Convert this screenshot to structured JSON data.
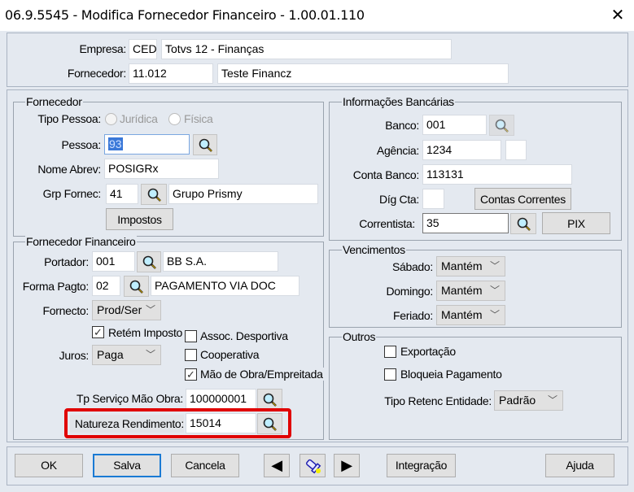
{
  "window": {
    "title": "06.9.5545 - Modifica Fornecedor Financeiro - 1.00.01.110",
    "close_icon": "close-icon"
  },
  "header": {
    "empresa_label": "Empresa:",
    "empresa_code": "CED",
    "empresa_name": "Totvs 12 - Finanças",
    "fornecedor_label": "Fornecedor:",
    "fornecedor_code": "11.012",
    "fornecedor_name": "Teste Financz"
  },
  "fornecedor": {
    "legend": "Fornecedor",
    "tipo_pessoa_label": "Tipo Pessoa:",
    "juridica": "Jurídica",
    "fisica": "Física",
    "pessoa_label": "Pessoa:",
    "pessoa": "93",
    "nome_abrev_label": "Nome Abrev:",
    "nome_abrev": "POSIGRx",
    "grp_label": "Grp Fornec:",
    "grp_code": "41",
    "grp_name": "Grupo Prismy",
    "impostos": "Impostos"
  },
  "financeiro": {
    "legend": "Fornecedor Financeiro",
    "portador_label": "Portador:",
    "portador_code": "001",
    "portador_name": "BB S.A.",
    "forma_label": "Forma Pagto:",
    "forma_code": "02",
    "forma_name": "PAGAMENTO VIA DOC",
    "fornecto_label": "Fornecto:",
    "fornecto": "Prod/Ser",
    "retem": "Retém Imposto",
    "juros_label": "Juros:",
    "juros": "Paga",
    "assoc": "Assoc. Desportiva",
    "cooperativa": "Cooperativa",
    "mao_obra": "Mão de Obra/Empreitada",
    "tp_servico_label": "Tp Serviço Mão Obra:",
    "tp_servico": "100000001",
    "natureza_label": "Natureza Rendimento:",
    "natureza": "15014",
    "checks": {
      "retem": true,
      "assoc": false,
      "cooperativa": false,
      "mao_obra": true
    },
    "highlight_color": "#e00000"
  },
  "banco": {
    "legend": "Informações Bancárias",
    "banco_label": "Banco:",
    "banco": "001",
    "agencia_label": "Agência:",
    "agencia": "1234",
    "agencia_dig": "",
    "conta_label": "Conta Banco:",
    "conta": "113131",
    "dig_label": "Díg Cta:",
    "dig": "",
    "contas_correntes": "Contas Correntes",
    "correntista_label": "Correntista:",
    "correntista": "35",
    "pix": "PIX"
  },
  "vencimentos": {
    "legend": "Vencimentos",
    "sabado_label": "Sábado:",
    "sabado": "Mantém",
    "domingo_label": "Domingo:",
    "domingo": "Mantém",
    "feriado_label": "Feriado:",
    "feriado": "Mantém"
  },
  "outros": {
    "legend": "Outros",
    "exportacao": "Exportação",
    "bloqueia": "Bloqueia Pagamento",
    "tipo_retenc_label": "Tipo Retenc Entidade:",
    "tipo_retenc": "Padrão"
  },
  "footer": {
    "ok": "OK",
    "salva": "Salva",
    "cancela": "Cancela",
    "integracao": "Integração",
    "ajuda": "Ajuda"
  }
}
